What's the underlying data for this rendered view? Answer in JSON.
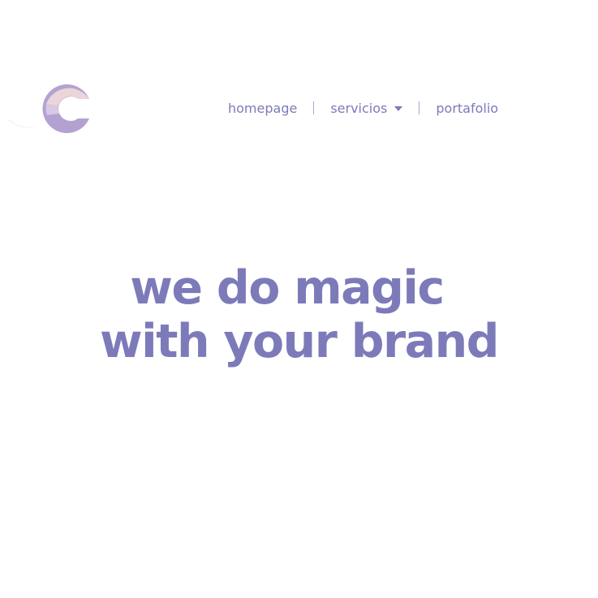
{
  "brand": {
    "logo_letter": "C",
    "colors": {
      "accent": "#7d7aba",
      "logo_purple": "#b3a2d1",
      "logo_peach": "#ead6d9",
      "logo_lavender": "#d8c8e3"
    }
  },
  "nav": {
    "items": [
      {
        "label": "homepage"
      },
      {
        "label": "servicios",
        "icon": "caret-down-icon"
      },
      {
        "label": "portafolio"
      }
    ]
  },
  "hero": {
    "line1": "we do magic",
    "line2": "with your brand"
  }
}
